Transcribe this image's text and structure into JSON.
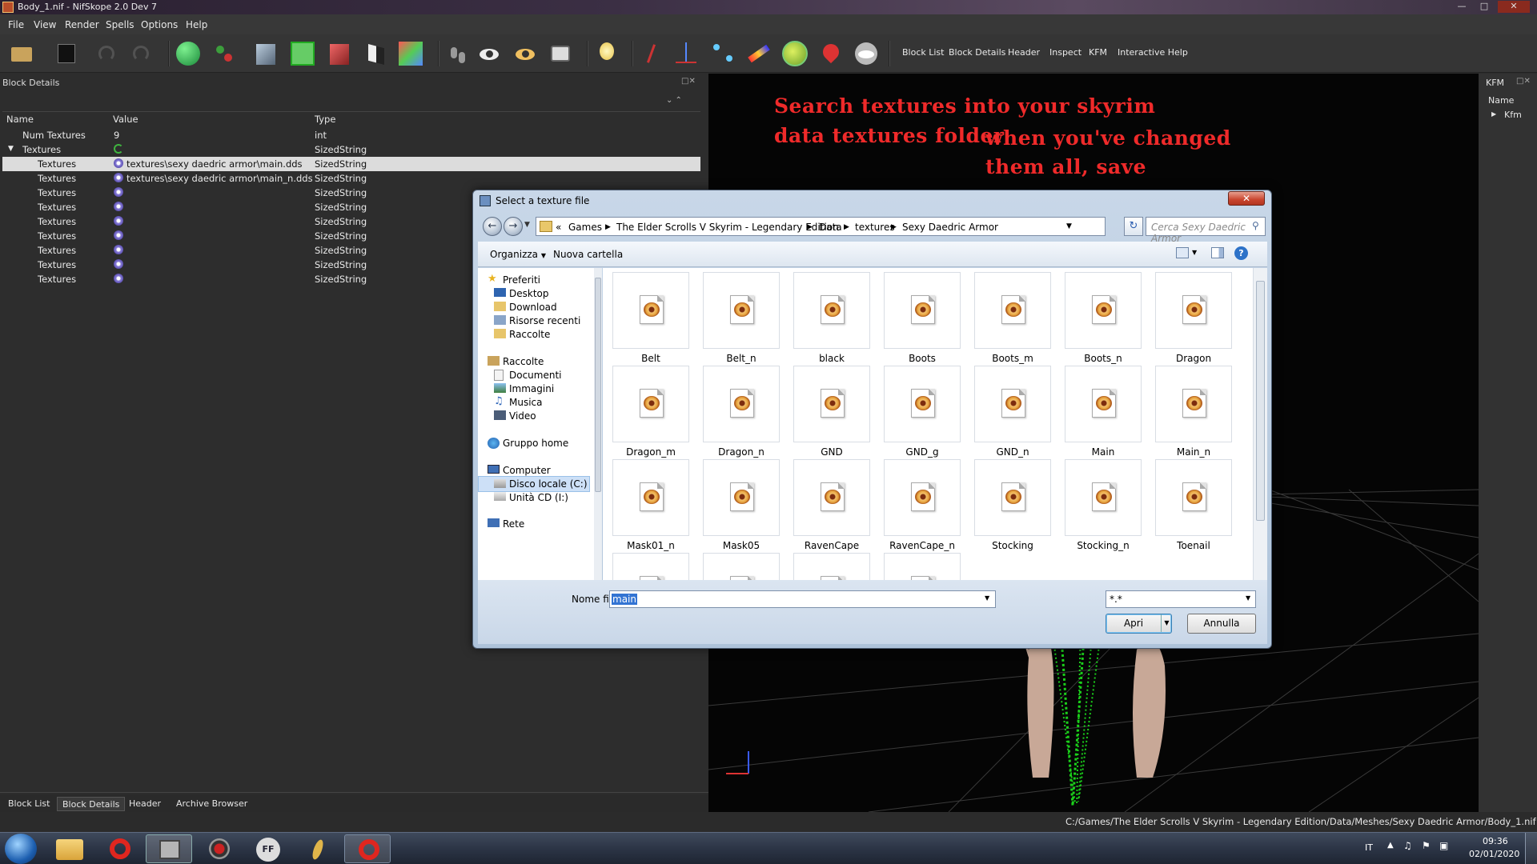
{
  "window": {
    "title": "Body_1.nif - NifSkope 2.0 Dev 7"
  },
  "menu": [
    "File",
    "View",
    "Render",
    "Spells",
    "Options",
    "Help"
  ],
  "toolbar": {
    "links": [
      "Block List",
      "Block Details",
      "Header",
      "Inspect",
      "KFM",
      "Interactive Help"
    ]
  },
  "block_details": {
    "title": "Block Details",
    "columns": [
      "Name",
      "Value",
      "Type"
    ],
    "rows": [
      {
        "name": "Num Textures",
        "value": "9",
        "type": "int"
      },
      {
        "name": "Textures",
        "value": "",
        "type": "SizedString"
      },
      {
        "name": "Textures",
        "value": "textures\\sexy daedric armor\\main.dds",
        "type": "SizedString"
      },
      {
        "name": "Textures",
        "value": "textures\\sexy daedric armor\\main_n.dds",
        "type": "SizedString"
      },
      {
        "name": "Textures",
        "value": "",
        "type": "SizedString"
      },
      {
        "name": "Textures",
        "value": "",
        "type": "SizedString"
      },
      {
        "name": "Textures",
        "value": "",
        "type": "SizedString"
      },
      {
        "name": "Textures",
        "value": "",
        "type": "SizedString"
      },
      {
        "name": "Textures",
        "value": "",
        "type": "SizedString"
      },
      {
        "name": "Textures",
        "value": "",
        "type": "SizedString"
      },
      {
        "name": "Textures",
        "value": "",
        "type": "SizedString"
      }
    ]
  },
  "bottom_tabs": [
    "Block List",
    "Block Details",
    "Header",
    "Archive Browser"
  ],
  "annotation": {
    "line1": "Search textures into your skyrim",
    "line2": "data textures folder",
    "line3": "when you've changed",
    "line4": "them all, save"
  },
  "kfm_panel": {
    "title": "KFM",
    "column": "Name",
    "item": "Kfm"
  },
  "status_path": "C:/Games/The Elder Scrolls V Skyrim - Legendary Edition/Data/Meshes/Sexy Daedric Armor/Body_1.nif",
  "dialog": {
    "title": "Select a texture file",
    "breadcrumb": [
      "«",
      "Games",
      "The Elder Scrolls V Skyrim - Legendary Edition",
      "Data",
      "textures",
      "Sexy Daedric Armor"
    ],
    "search_placeholder": "Cerca Sexy Daedric Armor",
    "organize": "Organizza",
    "new_folder": "Nuova cartella",
    "nav_items": [
      {
        "label": "Preferiti",
        "icon": "star-icon"
      },
      {
        "label": "Desktop",
        "icon": "desktop-icon"
      },
      {
        "label": "Download",
        "icon": "folder-icon"
      },
      {
        "label": "Risorse recenti",
        "icon": "recent-icon"
      },
      {
        "label": "Raccolte",
        "icon": "folder-icon"
      },
      {
        "label": "Raccolte",
        "icon": "library-icon"
      },
      {
        "label": "Documenti",
        "icon": "document-icon"
      },
      {
        "label": "Immagini",
        "icon": "image-icon"
      },
      {
        "label": "Musica",
        "icon": "music-icon"
      },
      {
        "label": "Video",
        "icon": "video-icon"
      },
      {
        "label": "Gruppo home",
        "icon": "homegroup-icon"
      },
      {
        "label": "Computer",
        "icon": "computer-icon"
      },
      {
        "label": "Disco locale (C:)",
        "icon": "disk-icon"
      },
      {
        "label": "Unità CD (I:)",
        "icon": "cd-icon"
      },
      {
        "label": "Rete",
        "icon": "network-icon"
      }
    ],
    "files": [
      "Belt",
      "Belt_n",
      "black",
      "Boots",
      "Boots_m",
      "Boots_n",
      "Dragon",
      "Dragon_m",
      "Dragon_n",
      "GND",
      "GND_g",
      "GND_n",
      "Main",
      "Main_n",
      "Mask01_n",
      "Mask05",
      "RavenCape",
      "RavenCape_n",
      "Stocking",
      "Stocking_n",
      "Toenail",
      "",
      "",
      "",
      ""
    ],
    "filename_label": "Nome file:",
    "filename_value": "main",
    "filter_value": "*.*",
    "open_button": "Apri",
    "cancel_button": "Annulla"
  },
  "taskbar": {
    "lang": "IT",
    "time": "09:36",
    "date": "02/01/2020"
  }
}
